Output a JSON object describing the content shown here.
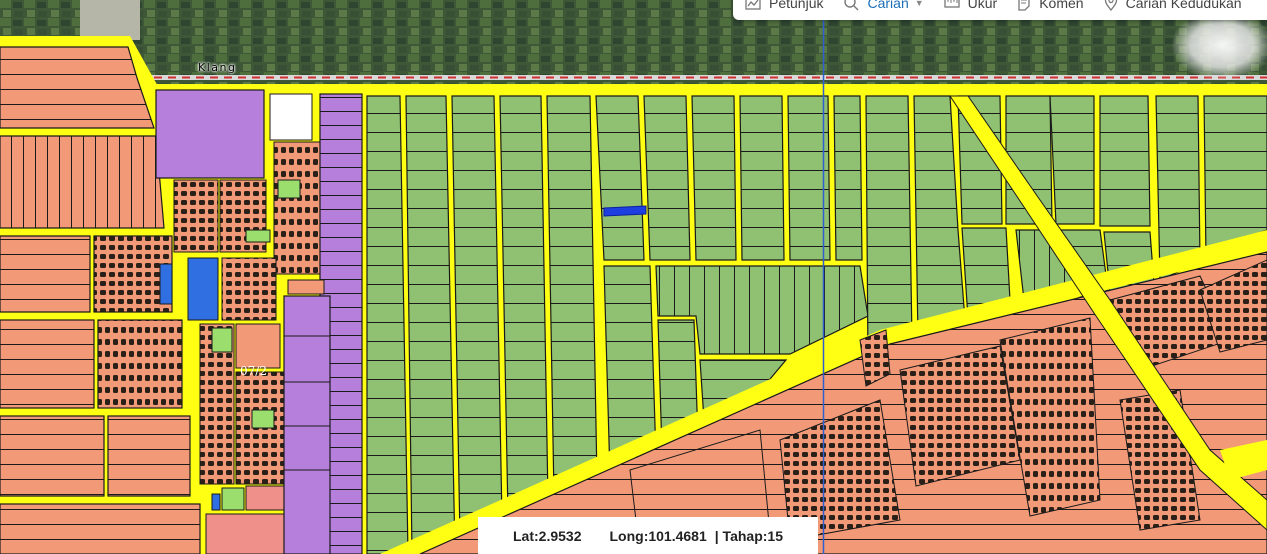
{
  "toolbar": {
    "items": [
      {
        "label": "Petunjuk",
        "icon": "map-icon"
      },
      {
        "label": "Carian",
        "icon": "search-icon",
        "active": true
      },
      {
        "label": "Ukur",
        "icon": "ruler-icon"
      },
      {
        "label": "Komen",
        "icon": "comment-icon"
      },
      {
        "label": "Carian Kedudukan",
        "icon": "location-pin-icon"
      }
    ]
  },
  "map": {
    "place_label": "Klang",
    "lot_code": "07/2"
  },
  "status": {
    "lat": "Lat:2.9532",
    "long": "Long:101.4681",
    "tahap": "| Tahap:15"
  },
  "colors": {
    "agriculture": "#90c172",
    "residential": "#f29a78",
    "institutional": "#b57fdb",
    "industrial": "#2f6fe2",
    "road": "#ffff14",
    "boundary": "#1a1a1a",
    "crosshair": "#2f5ecf",
    "toolbar_active": "#1c6fb8"
  }
}
